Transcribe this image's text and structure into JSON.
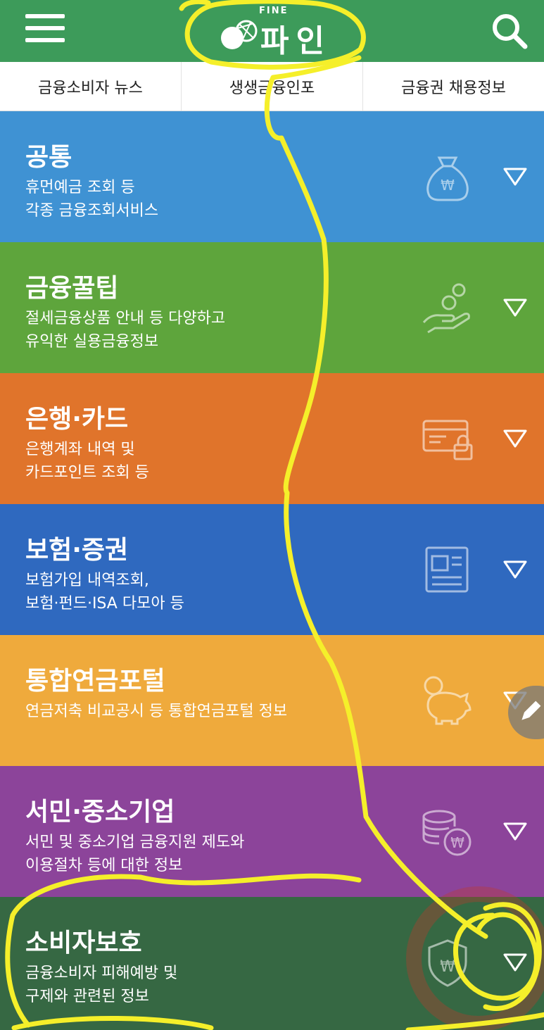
{
  "header": {
    "logo_small": "FINE",
    "logo_text": "파인",
    "menu_icon": "hamburger-menu-icon",
    "search_icon": "search-icon",
    "color": "#3d9b5a"
  },
  "tabs": [
    {
      "label": "금융소비자 뉴스"
    },
    {
      "label": "생생금융인포"
    },
    {
      "label": "금융권 채용정보"
    }
  ],
  "categories": [
    {
      "title": "공통",
      "desc": "휴먼예금 조회 등\n각종 금융조회서비스",
      "color": "#3f92d3",
      "icon": "money-bag-icon"
    },
    {
      "title": "금융꿀팁",
      "desc": "절세금융상품 안내 등 다양하고\n유익한 실용금융정보",
      "color": "#5ea53c",
      "icon": "hand-coins-icon"
    },
    {
      "title": "은행·카드",
      "desc": "은행계좌 내역 및\n카드포인트 조회 등",
      "color": "#e0742b",
      "icon": "card-lock-icon"
    },
    {
      "title": "보험·증권",
      "desc": "보험가입 내역조회,\n보험·펀드·ISA 다모아 등",
      "color": "#2f69bf",
      "icon": "newspaper-icon"
    },
    {
      "title": "통합연금포털",
      "desc": "연금저축 비교공시 등 통합연금포털 정보",
      "color": "#efaa3c",
      "icon": "piggy-bank-icon"
    },
    {
      "title": "서민·중소기업",
      "desc": "서민 및 중소기업 금융지원 제도와\n이용절차 등에 대한 정보",
      "color": "#8c449a",
      "icon": "coin-stack-icon"
    },
    {
      "title": "소비자보호",
      "desc": "금융소비자 피해예방 및\n구제와 관련된 정보",
      "color": "#366843",
      "icon": "shield-won-icon"
    }
  ],
  "annotation": {
    "color": "#f5ef2a",
    "highlight_color": "#c0392b"
  },
  "fab": {
    "icon": "pencil-icon"
  }
}
